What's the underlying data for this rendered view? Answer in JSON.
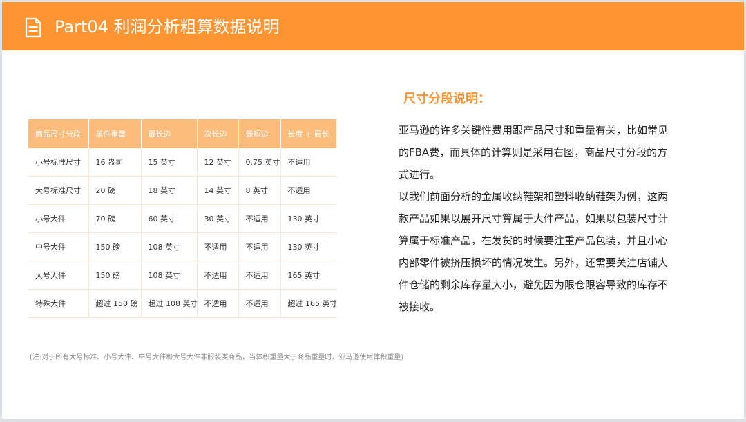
{
  "header": {
    "icon": "document-icon",
    "title": "Part04 利润分析粗算数据说明"
  },
  "table": {
    "columns": [
      "商品尺寸分段",
      "单件重量",
      "最长边",
      "次长边",
      "最短边",
      "长度 + 周长"
    ],
    "rows": [
      [
        "小号标准尺寸",
        "16 盎司",
        "15 英寸",
        "12 英寸",
        "0.75 英寸",
        "不适用"
      ],
      [
        "大号标准尺寸",
        "20 磅",
        "18 英寸",
        "14 英寸",
        "8 英寸",
        "不适用"
      ],
      [
        "小号大件",
        "70 磅",
        "60 英寸",
        "30 英寸",
        "不适用",
        "130 英寸"
      ],
      [
        "中号大件",
        "150 磅",
        "108 英寸",
        "不适用",
        "不适用",
        "130 英寸"
      ],
      [
        "大号大件",
        "150 磅",
        "108 英寸",
        "不适用",
        "不适用",
        "165 英寸"
      ],
      [
        "特殊大件",
        "超过 150 磅",
        "超过 108 英寸",
        "不适用",
        "不适用",
        "超过 165 英寸"
      ]
    ]
  },
  "section": {
    "title": "尺寸分段说明：",
    "paragraph1": "亚马逊的许多关键性费用跟产品尺寸和重量有关，比如常见的FBA费，而具体的计算则是采用右图，商品尺寸分段的方式进行。",
    "paragraph2": "以我们前面分析的金属收纳鞋架和塑料收纳鞋架为例，这两款产品如果以展开尺寸算属于大件产品，如果以包装尺寸计算属于标准产品，在发货的时候要注重产品包装，并且小心内部零件被挤压损坏的情况发生。另外，还需要关注店铺大件仓储的剩余库存量大小，避免因为限仓限容导致的库存不被接收。"
  },
  "note": "(注:对于所有大号标准、小号大件、中号大件和大号大件非服装类商品，当体积重量大于商品重量时，亚马逊使用体积重量)",
  "colors": {
    "accent": "#ff9433",
    "table_header": "#fbbc7c",
    "table_border": "#fbe6d4"
  }
}
